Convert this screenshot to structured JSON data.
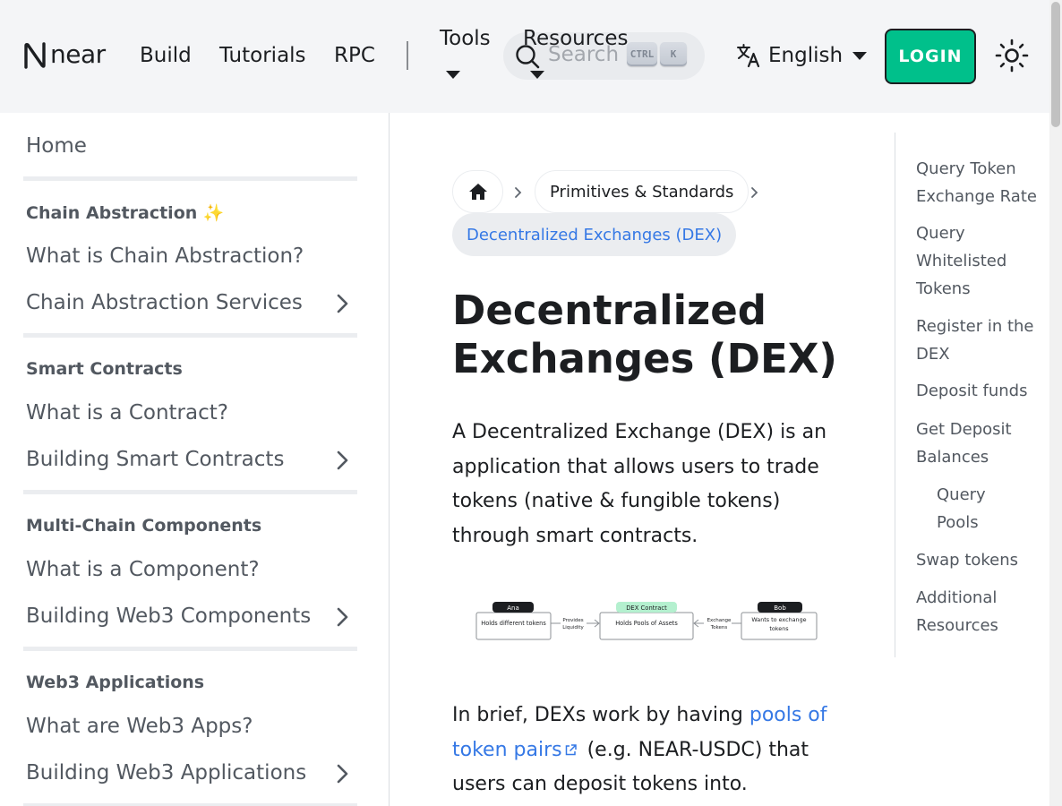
{
  "navbar": {
    "brand": "near",
    "links": [
      "Build",
      "Tutorials",
      "RPC"
    ],
    "tools_label": "Tools",
    "resources_label": "Resources",
    "search_placeholder": "Search",
    "shortcut_keys": [
      "CTRL",
      "K"
    ],
    "language": "English",
    "login_label": "LOGIN"
  },
  "sidebar": {
    "home": "Home",
    "sections": [
      {
        "title": "Chain Abstraction ✨",
        "items": [
          "What is Chain Abstraction?",
          "Chain Abstraction Services"
        ]
      },
      {
        "title": "Smart Contracts",
        "items": [
          "What is a Contract?",
          "Building Smart Contracts"
        ]
      },
      {
        "title": "Multi-Chain Components",
        "items": [
          "What is a Component?",
          "Building Web3 Components"
        ]
      },
      {
        "title": "Web3 Applications",
        "items": [
          "What are Web3 Apps?",
          "Building Web3 Applications"
        ]
      }
    ]
  },
  "breadcrumb": {
    "section": "Primitives & Standards",
    "current": "Decentralized Exchanges (DEX)"
  },
  "article": {
    "title": "Decentralized Exchanges (DEX)",
    "intro": "A Decentralized Exchange (DEX) is an application that allows users to trade tokens (native & fungible tokens) through smart contracts.",
    "brief_prefix": "In brief, DEXs work by having ",
    "brief_link": "pools of token pairs",
    "brief_suffix": " (e.g. NEAR-USDC) that users can deposit tokens into."
  },
  "diagram": {
    "ana_tag": "Ana",
    "ana_text": "Holds different tokens",
    "provides_liquidity": [
      "Provides",
      "Liquidity"
    ],
    "dex_tag": "DEX Contract",
    "dex_text": "Holds Pools of Assets",
    "exchange_tokens": [
      "Exchange",
      "Tokens"
    ],
    "bob_tag": "Bob",
    "bob_text": [
      "Wants to exchange",
      "tokens"
    ]
  },
  "toc": [
    "Query Token Exchange Rate",
    "Query Whitelisted Tokens",
    "Register in the DEX",
    "Deposit funds",
    "Get Deposit Balances",
    "Query Pools",
    "Swap tokens",
    "Additional Resources"
  ],
  "colors": {
    "accent": "#00c08b",
    "link": "#3578e5",
    "navbar_bg": "#f4f5f7",
    "text": "#1c1e21",
    "muted": "#525860"
  }
}
